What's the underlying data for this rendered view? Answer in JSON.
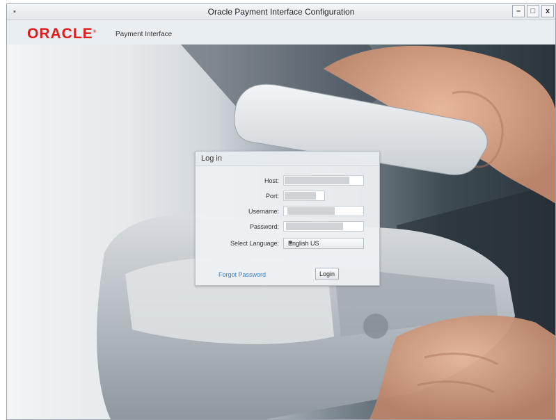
{
  "window": {
    "title": "Oracle Payment Interface Configuration",
    "controls": [
      "–",
      "□",
      "x"
    ]
  },
  "brand": {
    "logo_text": "ORACLE",
    "product": "Payment Interface",
    "logo_color": "#e21c1c"
  },
  "login": {
    "title": "Log in",
    "fields": [
      {
        "label": "Host:",
        "value_fill": 0.82
      },
      {
        "label": "Port:",
        "value_fill": 0.78
      },
      {
        "label": "Username:",
        "value_fill": 0.6
      },
      {
        "label": "Password:",
        "value_fill": 0.72
      }
    ],
    "language": {
      "label": "Select Language:",
      "selected": "English US"
    },
    "forgot_password": "Forgot Password",
    "login_button": "Login",
    "link_color": "#3c7dbf"
  },
  "icons": {
    "app": "app-icon",
    "dropdown": "chevron-down-icon"
  }
}
